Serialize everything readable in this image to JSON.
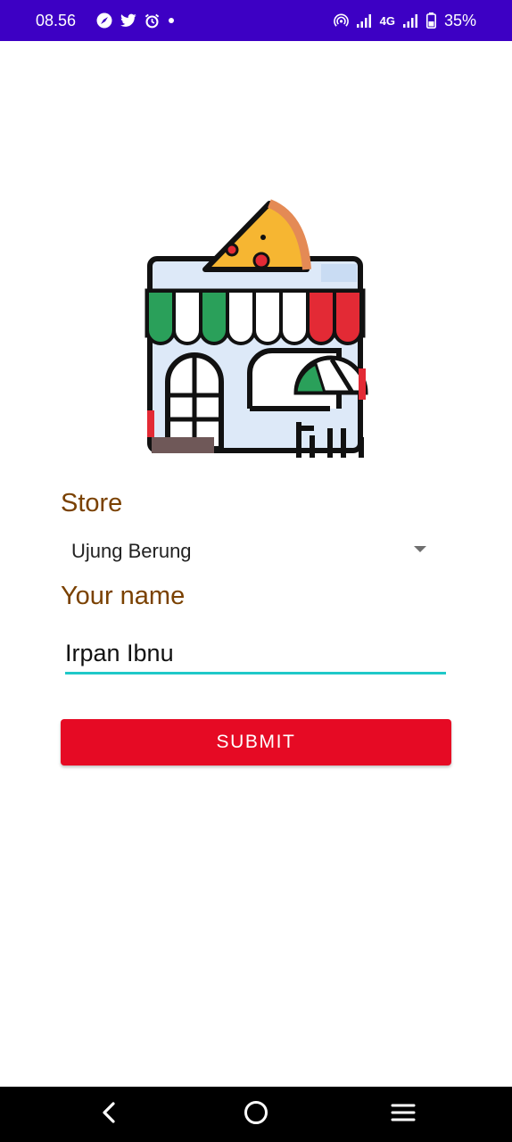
{
  "status_bar": {
    "time": "08.56",
    "network": "4G",
    "battery": "35%",
    "icons_left": [
      "nav-compass-icon",
      "twitter-icon",
      "alarm-icon",
      "dot-icon"
    ],
    "icons_right": [
      "hotspot-icon",
      "signal-icon",
      "signal-icon",
      "battery-icon"
    ]
  },
  "logo": {
    "icon": "pizza-store-icon"
  },
  "form": {
    "store_label": "Store",
    "store_selected": "Ujung Berung",
    "name_label": "Your name",
    "name_value": "Irpan Ibnu",
    "submit_label": "SUBMIT"
  },
  "colors": {
    "status_bar": "#3d00c4",
    "label": "#7a4100",
    "input_underline": "#1fc8c8",
    "submit_button": "#e60a24",
    "nav_bar": "#000000"
  },
  "nav_bar": {
    "icons": [
      "back-icon",
      "home-icon",
      "recents-icon"
    ]
  }
}
